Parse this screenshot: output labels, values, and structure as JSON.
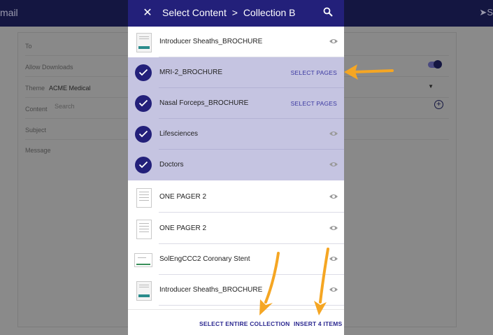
{
  "background": {
    "title": "mail",
    "send_label": "S",
    "fields": {
      "to": "To",
      "allow_downloads": "Allow Downloads",
      "theme_label": "Theme",
      "theme_value": "ACME Medical",
      "content_label": "Content",
      "content_search_placeholder": "Search",
      "subject": "Subject",
      "message": "Message"
    }
  },
  "modal": {
    "title": "Select Content",
    "breadcrumb_sep": ">",
    "collection": "Collection B",
    "items": [
      {
        "name": "Introducer Sheaths_BROCHURE",
        "selected": false,
        "action": "preview"
      },
      {
        "name": "MRI-2_BROCHURE",
        "selected": true,
        "action": "SELECT PAGES"
      },
      {
        "name": "Nasal Forceps_BROCHURE",
        "selected": true,
        "action": "SELECT PAGES"
      },
      {
        "name": "Lifesciences",
        "selected": true,
        "action": "preview"
      },
      {
        "name": "Doctors",
        "selected": true,
        "action": "preview"
      },
      {
        "name": "ONE PAGER 2",
        "selected": false,
        "action": "preview"
      },
      {
        "name": "ONE PAGER 2",
        "selected": false,
        "action": "preview"
      },
      {
        "name": "SolEngCCC2 Coronary Stent",
        "selected": false,
        "action": "preview"
      },
      {
        "name": "Introducer Sheaths_BROCHURE",
        "selected": false,
        "action": "preview"
      }
    ],
    "footer": {
      "select_collection": "SELECT ENTIRE COLLECTION",
      "insert": "INSERT 4 ITEMS"
    }
  },
  "colors": {
    "header": "#23207a",
    "selected_row": "#c5c4e1",
    "arrow": "#f5a623"
  }
}
